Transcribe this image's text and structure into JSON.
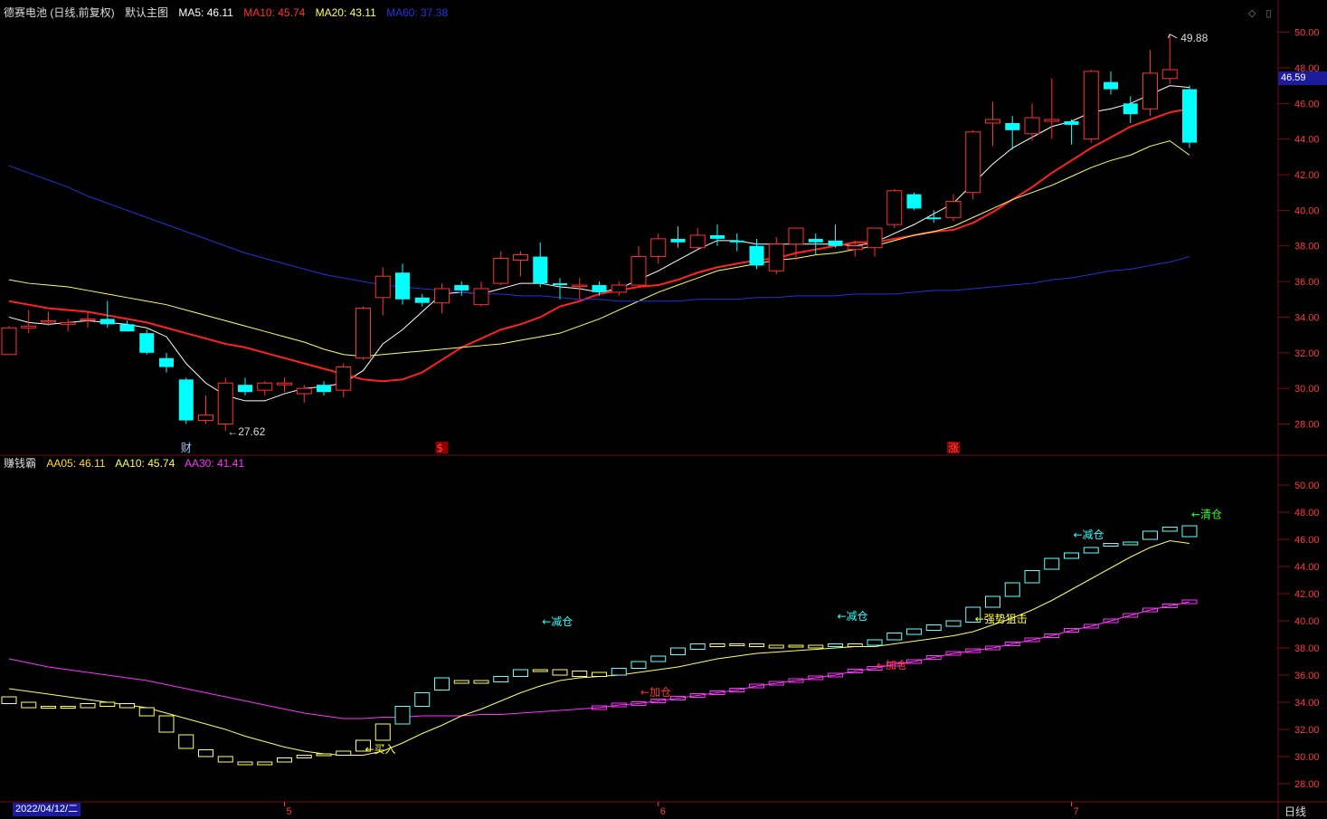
{
  "header_top": {
    "symbol": "德赛电池 (日线,前复权)",
    "view": "默认主图",
    "ma5": "MA5: 46.11",
    "ma10": "MA10: 45.74",
    "ma20": "MA20: 43.11",
    "ma60": "MA60: 37.38"
  },
  "header_bottom": {
    "indicator": "赚钱霸",
    "aa05": "AA05: 46.11",
    "aa10": "AA10: 45.74",
    "aa30": "AA30: 41.41"
  },
  "period_label": "日线",
  "date_label": "2022/04/12/二",
  "current_price_tag": "46.59",
  "colors": {
    "up": "#ff3232",
    "down": "#00ffff",
    "ma5": "#ffffff",
    "ma10": "#ff2222",
    "ma20": "#ffff66",
    "ma60": "#2233dd",
    "aa30": "#ff33ff",
    "grid": "#7a0a0a"
  },
  "chart_data": [
    {
      "type": "candlestick",
      "y_ticks": [
        "28.00",
        "30.00",
        "32.00",
        "34.00",
        "36.00",
        "38.00",
        "40.00",
        "42.00",
        "44.00",
        "46.00",
        "48.00",
        "50.00"
      ],
      "ylim": [
        26.4,
        51.2
      ],
      "candles": [
        {
          "o": 31.9,
          "h": 33.5,
          "l": 31.9,
          "c": 33.4
        },
        {
          "o": 33.4,
          "h": 34.4,
          "l": 33.1,
          "c": 33.5
        },
        {
          "o": 33.8,
          "h": 34.3,
          "l": 33.5,
          "c": 33.8
        },
        {
          "o": 33.6,
          "h": 33.9,
          "l": 33.2,
          "c": 33.7
        },
        {
          "o": 33.9,
          "h": 34.3,
          "l": 33.4,
          "c": 33.9
        },
        {
          "o": 33.9,
          "h": 34.9,
          "l": 33.4,
          "c": 33.6
        },
        {
          "o": 33.6,
          "h": 33.8,
          "l": 33.2,
          "c": 33.2
        },
        {
          "o": 33.1,
          "h": 33.3,
          "l": 31.9,
          "c": 32.0
        },
        {
          "o": 31.7,
          "h": 32.0,
          "l": 30.9,
          "c": 31.2
        },
        {
          "o": 30.5,
          "h": 30.6,
          "l": 28.0,
          "c": 28.2
        },
        {
          "o": 28.2,
          "h": 29.6,
          "l": 28.0,
          "c": 28.5
        },
        {
          "o": 28.0,
          "h": 30.6,
          "l": 27.6,
          "c": 30.3
        },
        {
          "o": 30.2,
          "h": 30.6,
          "l": 29.6,
          "c": 29.8
        },
        {
          "o": 29.9,
          "h": 30.4,
          "l": 29.6,
          "c": 30.3
        },
        {
          "o": 30.2,
          "h": 30.6,
          "l": 29.8,
          "c": 30.3
        },
        {
          "o": 29.7,
          "h": 30.2,
          "l": 29.2,
          "c": 30.0
        },
        {
          "o": 30.2,
          "h": 30.4,
          "l": 29.6,
          "c": 29.8
        },
        {
          "o": 29.9,
          "h": 31.4,
          "l": 29.5,
          "c": 31.2
        },
        {
          "o": 31.7,
          "h": 34.6,
          "l": 31.6,
          "c": 34.5
        },
        {
          "o": 35.1,
          "h": 36.8,
          "l": 34.1,
          "c": 36.3
        },
        {
          "o": 36.5,
          "h": 37.0,
          "l": 34.7,
          "c": 35.0
        },
        {
          "o": 35.1,
          "h": 35.3,
          "l": 34.6,
          "c": 34.8
        },
        {
          "o": 34.8,
          "h": 35.9,
          "l": 34.2,
          "c": 35.6
        },
        {
          "o": 35.8,
          "h": 36.0,
          "l": 35.2,
          "c": 35.5
        },
        {
          "o": 34.7,
          "h": 36.0,
          "l": 34.6,
          "c": 35.6
        },
        {
          "o": 35.9,
          "h": 37.7,
          "l": 35.8,
          "c": 37.3
        },
        {
          "o": 37.2,
          "h": 37.7,
          "l": 36.3,
          "c": 37.5
        },
        {
          "o": 37.4,
          "h": 38.2,
          "l": 35.7,
          "c": 35.9
        },
        {
          "o": 35.9,
          "h": 36.2,
          "l": 35.0,
          "c": 35.8
        },
        {
          "o": 35.8,
          "h": 36.2,
          "l": 35.0,
          "c": 35.8
        },
        {
          "o": 35.8,
          "h": 36.0,
          "l": 35.2,
          "c": 35.4
        },
        {
          "o": 35.4,
          "h": 36.0,
          "l": 35.2,
          "c": 35.8
        },
        {
          "o": 35.8,
          "h": 38.0,
          "l": 35.7,
          "c": 37.4
        },
        {
          "o": 37.4,
          "h": 38.7,
          "l": 37.0,
          "c": 38.4
        },
        {
          "o": 38.4,
          "h": 39.1,
          "l": 37.9,
          "c": 38.2
        },
        {
          "o": 37.9,
          "h": 39.0,
          "l": 37.8,
          "c": 38.6
        },
        {
          "o": 38.6,
          "h": 39.2,
          "l": 38.0,
          "c": 38.4
        },
        {
          "o": 38.3,
          "h": 38.7,
          "l": 37.7,
          "c": 38.2
        },
        {
          "o": 38.0,
          "h": 38.4,
          "l": 36.7,
          "c": 36.9
        },
        {
          "o": 36.6,
          "h": 38.5,
          "l": 36.4,
          "c": 38.1
        },
        {
          "o": 38.1,
          "h": 39.0,
          "l": 37.2,
          "c": 39.0
        },
        {
          "o": 38.4,
          "h": 38.7,
          "l": 37.5,
          "c": 38.2
        },
        {
          "o": 38.3,
          "h": 39.2,
          "l": 37.9,
          "c": 38.0
        },
        {
          "o": 37.8,
          "h": 38.3,
          "l": 37.4,
          "c": 38.0
        },
        {
          "o": 37.9,
          "h": 39.0,
          "l": 37.4,
          "c": 39.0
        },
        {
          "o": 39.2,
          "h": 41.2,
          "l": 39.0,
          "c": 41.1
        },
        {
          "o": 40.9,
          "h": 41.0,
          "l": 40.0,
          "c": 40.1
        },
        {
          "o": 39.6,
          "h": 40.0,
          "l": 39.3,
          "c": 39.5
        },
        {
          "o": 39.6,
          "h": 40.9,
          "l": 39.4,
          "c": 40.5
        },
        {
          "o": 41.0,
          "h": 44.5,
          "l": 40.6,
          "c": 44.4
        },
        {
          "o": 44.9,
          "h": 46.1,
          "l": 43.6,
          "c": 45.1
        },
        {
          "o": 44.9,
          "h": 45.3,
          "l": 43.4,
          "c": 44.5
        },
        {
          "o": 44.3,
          "h": 46.0,
          "l": 43.9,
          "c": 45.2
        },
        {
          "o": 45.0,
          "h": 47.4,
          "l": 44.0,
          "c": 45.1
        },
        {
          "o": 45.0,
          "h": 45.1,
          "l": 43.7,
          "c": 44.8
        },
        {
          "o": 44.0,
          "h": 47.9,
          "l": 43.8,
          "c": 47.8
        },
        {
          "o": 47.2,
          "h": 47.8,
          "l": 46.5,
          "c": 46.8
        },
        {
          "o": 46.0,
          "h": 46.4,
          "l": 44.9,
          "c": 45.4
        },
        {
          "o": 45.7,
          "h": 49.0,
          "l": 45.3,
          "c": 47.7
        },
        {
          "o": 47.4,
          "h": 49.9,
          "l": 47.1,
          "c": 47.9
        },
        {
          "o": 46.8,
          "h": 47.0,
          "l": 43.5,
          "c": 43.8
        }
      ],
      "ma_series": [
        {
          "name": "MA5",
          "values": [
            34.0,
            33.7,
            33.6,
            33.7,
            33.8,
            33.7,
            33.6,
            33.4,
            32.9,
            31.4,
            30.3,
            29.6,
            29.3,
            29.3,
            29.7,
            30.0,
            30.1,
            30.3,
            31.0,
            32.5,
            33.3,
            34.3,
            35.3,
            35.4,
            35.3,
            35.6,
            35.9,
            35.9,
            35.7,
            35.6,
            35.4,
            35.6,
            36.1,
            36.6,
            37.2,
            37.8,
            38.3,
            38.3,
            38.1,
            38.1,
            38.1,
            38.1,
            38.1,
            38.0,
            38.2,
            38.7,
            39.2,
            39.8,
            40.4,
            41.5,
            42.6,
            43.5,
            44.1,
            44.7,
            45.0,
            45.5,
            45.7,
            46.0,
            46.5,
            47.0,
            46.9
          ]
        },
        {
          "name": "MA10",
          "values": [
            34.9,
            34.7,
            34.5,
            34.4,
            34.3,
            34.1,
            33.9,
            33.7,
            33.4,
            33.1,
            32.8,
            32.5,
            32.3,
            32.0,
            31.7,
            31.4,
            31.1,
            30.8,
            30.5,
            30.4,
            30.5,
            30.9,
            31.6,
            32.3,
            32.8,
            33.3,
            33.6,
            34.0,
            34.6,
            34.9,
            35.3,
            35.5,
            35.7,
            35.8,
            36.1,
            36.5,
            36.8,
            37.0,
            37.2,
            37.3,
            37.6,
            37.8,
            38.0,
            38.2,
            38.2,
            38.4,
            38.6,
            38.8,
            38.9,
            39.3,
            39.9,
            40.6,
            41.3,
            42.1,
            42.8,
            43.5,
            44.1,
            44.7,
            45.1,
            45.5,
            45.7
          ]
        },
        {
          "name": "MA20",
          "values": [
            36.1,
            35.9,
            35.8,
            35.7,
            35.5,
            35.3,
            35.1,
            34.9,
            34.7,
            34.4,
            34.1,
            33.8,
            33.5,
            33.2,
            32.9,
            32.6,
            32.2,
            31.9,
            31.8,
            31.9,
            32.0,
            32.1,
            32.2,
            32.3,
            32.4,
            32.5,
            32.7,
            32.9,
            33.1,
            33.5,
            33.9,
            34.4,
            34.9,
            35.4,
            35.8,
            36.2,
            36.6,
            36.8,
            37.0,
            37.2,
            37.3,
            37.5,
            37.6,
            37.8,
            38.0,
            38.3,
            38.6,
            38.8,
            39.1,
            39.6,
            40.1,
            40.6,
            41.0,
            41.4,
            41.9,
            42.4,
            42.8,
            43.1,
            43.6,
            43.9,
            43.1
          ]
        },
        {
          "name": "MA60",
          "values": [
            42.5,
            42.1,
            41.7,
            41.3,
            40.8,
            40.4,
            40.0,
            39.6,
            39.2,
            38.8,
            38.4,
            38.0,
            37.6,
            37.3,
            37.0,
            36.7,
            36.4,
            36.2,
            36.0,
            35.8,
            35.7,
            35.6,
            35.5,
            35.4,
            35.3,
            35.3,
            35.2,
            35.2,
            35.1,
            35.0,
            35.0,
            34.9,
            34.9,
            34.9,
            34.9,
            35.0,
            35.0,
            35.0,
            35.1,
            35.1,
            35.2,
            35.2,
            35.2,
            35.3,
            35.3,
            35.3,
            35.4,
            35.5,
            35.5,
            35.6,
            35.7,
            35.8,
            35.9,
            36.1,
            36.2,
            36.4,
            36.6,
            36.7,
            36.9,
            37.1,
            37.4
          ]
        }
      ],
      "annotations": [
        {
          "text": "←27.62",
          "price": 27.62,
          "index": 11
        },
        {
          "text": "49.88",
          "price": 49.88,
          "index": 59
        },
        {
          "text": "财",
          "index": 9,
          "kind": "marker"
        },
        {
          "text": "$",
          "index": 22,
          "kind": "marker"
        },
        {
          "text": "涨",
          "index": 48,
          "kind": "marker"
        }
      ]
    },
    {
      "type": "indicator-boxes",
      "y_ticks": [
        "28.00",
        "30.00",
        "32.00",
        "34.00",
        "36.00",
        "38.00",
        "40.00",
        "42.00",
        "44.00",
        "46.00",
        "48.00",
        "50.00"
      ],
      "ylim": [
        26.8,
        51.2
      ],
      "boxes": [
        {
          "top": 34.4,
          "bot": 33.9
        },
        {
          "top": 34.0,
          "bot": 33.6
        },
        {
          "top": 33.7,
          "bot": 33.6
        },
        {
          "top": 33.7,
          "bot": 33.6
        },
        {
          "top": 33.9,
          "bot": 33.6
        },
        {
          "top": 34.0,
          "bot": 33.7
        },
        {
          "top": 33.9,
          "bot": 33.6
        },
        {
          "top": 33.6,
          "bot": 33.0
        },
        {
          "top": 33.0,
          "bot": 31.8
        },
        {
          "top": 31.6,
          "bot": 30.6
        },
        {
          "top": 30.5,
          "bot": 30.0
        },
        {
          "top": 30.0,
          "bot": 29.6
        },
        {
          "top": 29.6,
          "bot": 29.4
        },
        {
          "top": 29.6,
          "bot": 29.4
        },
        {
          "top": 29.9,
          "bot": 29.6
        },
        {
          "top": 30.1,
          "bot": 29.9
        },
        {
          "top": 30.2,
          "bot": 30.1
        },
        {
          "top": 30.4,
          "bot": 30.1
        },
        {
          "top": 31.2,
          "bot": 30.4
        },
        {
          "top": 32.4,
          "bot": 31.2
        },
        {
          "top": 33.7,
          "bot": 32.4
        },
        {
          "top": 34.7,
          "bot": 33.7
        },
        {
          "top": 35.8,
          "bot": 34.9
        },
        {
          "top": 35.6,
          "bot": 35.4
        },
        {
          "top": 35.6,
          "bot": 35.4
        },
        {
          "top": 35.9,
          "bot": 35.5
        },
        {
          "top": 36.4,
          "bot": 35.9
        },
        {
          "top": 36.4,
          "bot": 36.4
        },
        {
          "top": 36.4,
          "bot": 36.0
        },
        {
          "top": 36.3,
          "bot": 35.9
        },
        {
          "top": 36.2,
          "bot": 35.9
        },
        {
          "top": 36.5,
          "bot": 36.0
        },
        {
          "top": 37.0,
          "bot": 36.5
        },
        {
          "top": 37.4,
          "bot": 37.0
        },
        {
          "top": 38.0,
          "bot": 37.5
        },
        {
          "top": 38.3,
          "bot": 37.9
        },
        {
          "top": 38.3,
          "bot": 38.1
        },
        {
          "top": 38.3,
          "bot": 38.2
        },
        {
          "top": 38.3,
          "bot": 38.1
        },
        {
          "top": 38.2,
          "bot": 38.0
        },
        {
          "top": 38.2,
          "bot": 38.1
        },
        {
          "top": 38.2,
          "bot": 38.0
        },
        {
          "top": 38.3,
          "bot": 38.1
        },
        {
          "top": 38.3,
          "bot": 38.1
        },
        {
          "top": 38.6,
          "bot": 38.2
        },
        {
          "top": 39.1,
          "bot": 38.6
        },
        {
          "top": 39.4,
          "bot": 39.0
        },
        {
          "top": 39.7,
          "bot": 39.3
        },
        {
          "top": 40.0,
          "bot": 39.6
        },
        {
          "top": 41.0,
          "bot": 39.9
        },
        {
          "top": 41.8,
          "bot": 41.0
        },
        {
          "top": 42.8,
          "bot": 41.8
        },
        {
          "top": 43.7,
          "bot": 42.8
        },
        {
          "top": 44.6,
          "bot": 43.8
        },
        {
          "top": 45.0,
          "bot": 44.6
        },
        {
          "top": 45.4,
          "bot": 45.0
        },
        {
          "top": 45.7,
          "bot": 45.5
        },
        {
          "top": 45.8,
          "bot": 45.6
        },
        {
          "top": 46.6,
          "bot": 46.0
        },
        {
          "top": 46.9,
          "bot": 46.6
        },
        {
          "top": 47.0,
          "bot": 46.2
        }
      ],
      "aa10": [
        35.0,
        34.8,
        34.6,
        34.4,
        34.2,
        34.0,
        33.8,
        33.6,
        33.2,
        32.8,
        32.4,
        32.0,
        31.5,
        31.1,
        30.7,
        30.4,
        30.2,
        30.1,
        30.1,
        30.4,
        31.0,
        31.7,
        32.3,
        33.0,
        33.5,
        34.1,
        34.7,
        35.2,
        35.6,
        35.8,
        35.9,
        36.0,
        36.2,
        36.4,
        36.6,
        36.9,
        37.2,
        37.4,
        37.6,
        37.7,
        37.8,
        37.9,
        38.0,
        38.1,
        38.1,
        38.3,
        38.5,
        38.7,
        38.9,
        39.2,
        39.7,
        40.2,
        40.8,
        41.5,
        42.3,
        43.1,
        43.9,
        44.7,
        45.4,
        45.9,
        45.7
      ],
      "aa30": [
        37.2,
        36.9,
        36.6,
        36.4,
        36.2,
        36.0,
        35.8,
        35.6,
        35.3,
        35.0,
        34.7,
        34.4,
        34.1,
        33.8,
        33.5,
        33.2,
        33.0,
        32.8,
        32.8,
        32.9,
        32.9,
        33.0,
        33.0,
        33.0,
        33.1,
        33.1,
        33.2,
        33.3,
        33.4,
        33.5,
        33.6,
        33.8,
        33.9,
        34.1,
        34.3,
        34.5,
        34.7,
        34.9,
        35.2,
        35.4,
        35.6,
        35.8,
        36.0,
        36.3,
        36.5,
        36.8,
        37.0,
        37.3,
        37.6,
        37.8,
        38.0,
        38.3,
        38.6,
        38.9,
        39.3,
        39.6,
        40.0,
        40.4,
        40.8,
        41.1,
        41.4
      ],
      "annotations": [
        {
          "text": "←买入",
          "index": 18,
          "price": 30.6,
          "color": "#ffff33"
        },
        {
          "text": "←减仓",
          "index": 27,
          "price": 40.0,
          "color": "#33ffff"
        },
        {
          "text": "←加仓",
          "index": 32,
          "price": 34.8,
          "color": "#ff3333"
        },
        {
          "text": "←减仓",
          "index": 42,
          "price": 40.4,
          "color": "#33ffff"
        },
        {
          "text": "←加仓",
          "index": 44,
          "price": 36.8,
          "color": "#ff3333"
        },
        {
          "text": "←强势狙击",
          "index": 49,
          "price": 40.2,
          "color": "#ffff33"
        },
        {
          "text": "←减仓",
          "index": 54,
          "price": 46.4,
          "color": "#33ffff"
        },
        {
          "text": "←清仓",
          "index": 60,
          "price": 47.9,
          "color": "#33ff33"
        }
      ]
    }
  ],
  "x_axis": {
    "month_labels": [
      {
        "text": "5",
        "index": 14
      },
      {
        "text": "6",
        "index": 33
      },
      {
        "text": "7",
        "index": 54
      }
    ]
  }
}
